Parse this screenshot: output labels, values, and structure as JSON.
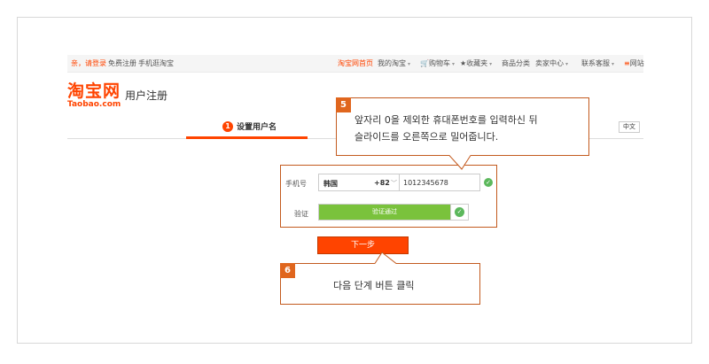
{
  "topbar": {
    "greeting": "亲，请登录",
    "register": "免费注册",
    "mobile": "手机逛淘宝",
    "home": "淘宝网首页",
    "my_taobao": "我的淘宝",
    "cart": "购物车",
    "favorites": "收藏夹",
    "categories": "商品分类",
    "seller": "卖家中心",
    "service": "联系客服",
    "sitemap": "网站"
  },
  "logo": {
    "cn": "淘宝网",
    "en": "Taobao.com"
  },
  "page_title": "用户注册",
  "steps": [
    {
      "num": "1",
      "label": "设置用户名"
    }
  ],
  "language": "中文",
  "form": {
    "phone_label": "手机号",
    "country_name": "韩国",
    "country_code": "+82",
    "phone_value": "1012345678",
    "verify_label": "验证",
    "slider_text": "验证通过",
    "next_button": "下一步"
  },
  "callouts": {
    "c5": {
      "num": "5",
      "line1": "앞자리 0을 제외한 휴대폰번호를 입력하신 뒤",
      "line2": "슬라이드를 오른쪽으로 밀어줍니다."
    },
    "c6": {
      "num": "6",
      "text": "다음 단계 버튼 클릭"
    }
  },
  "colors": {
    "accent": "#ff4400",
    "callout_border": "#c35a1e",
    "success": "#7ac23c"
  }
}
